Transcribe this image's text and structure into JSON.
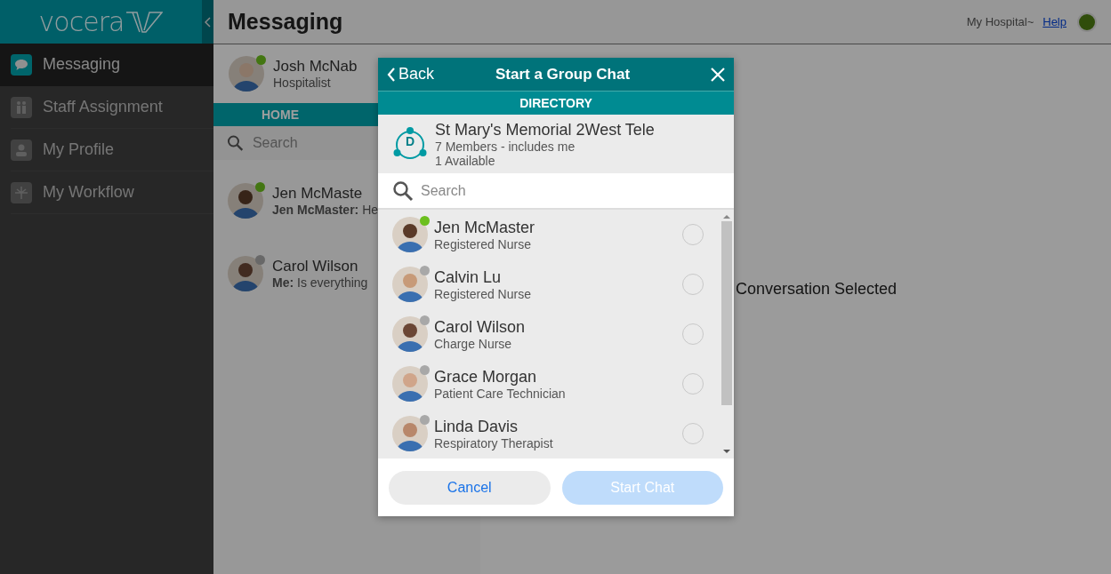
{
  "logo": "vocera",
  "sidebar": {
    "items": [
      {
        "label": "Messaging",
        "selected": true
      },
      {
        "label": "Staff Assignment",
        "selected": false
      },
      {
        "label": "My Profile",
        "selected": false
      },
      {
        "label": "My Workflow",
        "selected": false
      }
    ]
  },
  "header": {
    "title": "Messaging",
    "facility": "My Hospital~",
    "help": "Help"
  },
  "user": {
    "name": "Josh McNab",
    "role": "Hospitalist",
    "available": true
  },
  "home_tab": "HOME",
  "conversation_search": {
    "placeholder": "Search"
  },
  "conversations": [
    {
      "name": "Jen McMaste",
      "preview": "**Jen McMaster:** He",
      "available": true
    },
    {
      "name": "Carol Wilson",
      "preview": "**Me:** Is everything",
      "available": false
    }
  ],
  "empty_state": "Conversation Selected",
  "dialog": {
    "back": "Back",
    "title": "Start a Group Chat",
    "section": "DIRECTORY",
    "group": {
      "badge": "D",
      "name": "St Mary's Memorial 2West Tele",
      "members": "7 Members - includes me",
      "available": "1 Available"
    },
    "search": {
      "placeholder": "Search"
    },
    "people": [
      {
        "name": "Jen McMaster",
        "role": "Registered Nurse",
        "available": true,
        "selected": false
      },
      {
        "name": "Calvin Lu",
        "role": "Registered Nurse",
        "available": false,
        "selected": false
      },
      {
        "name": "Carol Wilson",
        "role": "Charge Nurse",
        "available": false,
        "selected": false
      },
      {
        "name": "Grace Morgan",
        "role": "Patient Care Technician",
        "available": false,
        "selected": false
      },
      {
        "name": "Linda Davis",
        "role": "Respiratory Therapist",
        "available": false,
        "selected": false
      }
    ],
    "cancel": "Cancel",
    "start": "Start Chat",
    "start_disabled": true
  }
}
